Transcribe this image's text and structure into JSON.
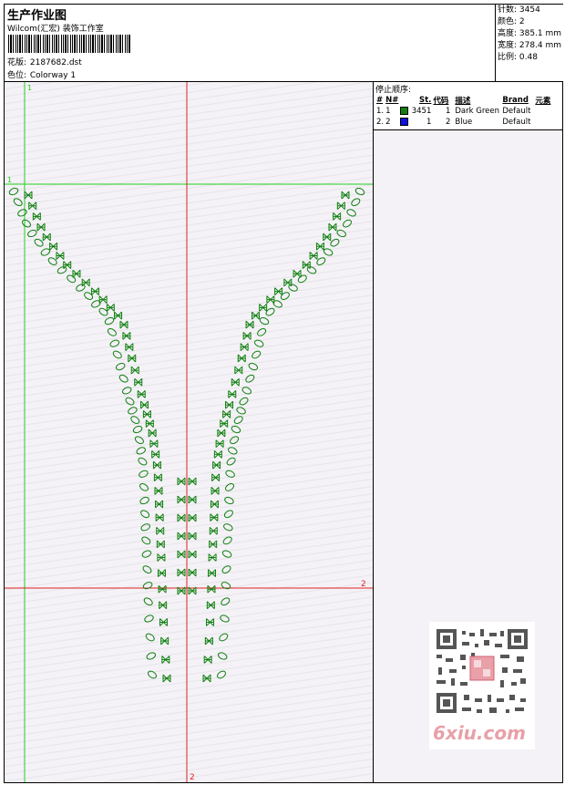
{
  "header": {
    "title": "生产作业图",
    "company": "Wilcom(汇宏) 装饰工作室",
    "design_label": "花版:",
    "design_value": "2187682.dst",
    "colorway_label": "色位:",
    "colorway_value": "Colorway 1"
  },
  "stats": {
    "stitches": "针数: 3454",
    "colors": "颜色: 2",
    "height": "高度: 385.1 mm",
    "width": "宽度: 278.4 mm",
    "ratio": "比例: 0.48"
  },
  "stop_panel": {
    "title": "停止顺序:",
    "headers": [
      "#",
      "N#",
      "",
      "St.",
      "代码",
      "描述",
      "Brand",
      "元素"
    ],
    "rows": [
      {
        "idx": "1.",
        "n": "1",
        "color": "#108010",
        "st": "3451",
        "code": "1",
        "desc": "Dark Green",
        "brand": "Default"
      },
      {
        "idx": "2.",
        "n": "2",
        "color": "#1010e0",
        "st": "1",
        "code": "2",
        "desc": "Blue",
        "brand": "Default"
      }
    ]
  },
  "guides": {
    "green_v": "1",
    "green_h": "1",
    "red_h": "2",
    "red_v": "2"
  },
  "colors": {
    "stitch": "#108010",
    "guide_green": "#20d020",
    "guide_red": "#e02020"
  },
  "watermark": {
    "site": "6xiu.com"
  }
}
